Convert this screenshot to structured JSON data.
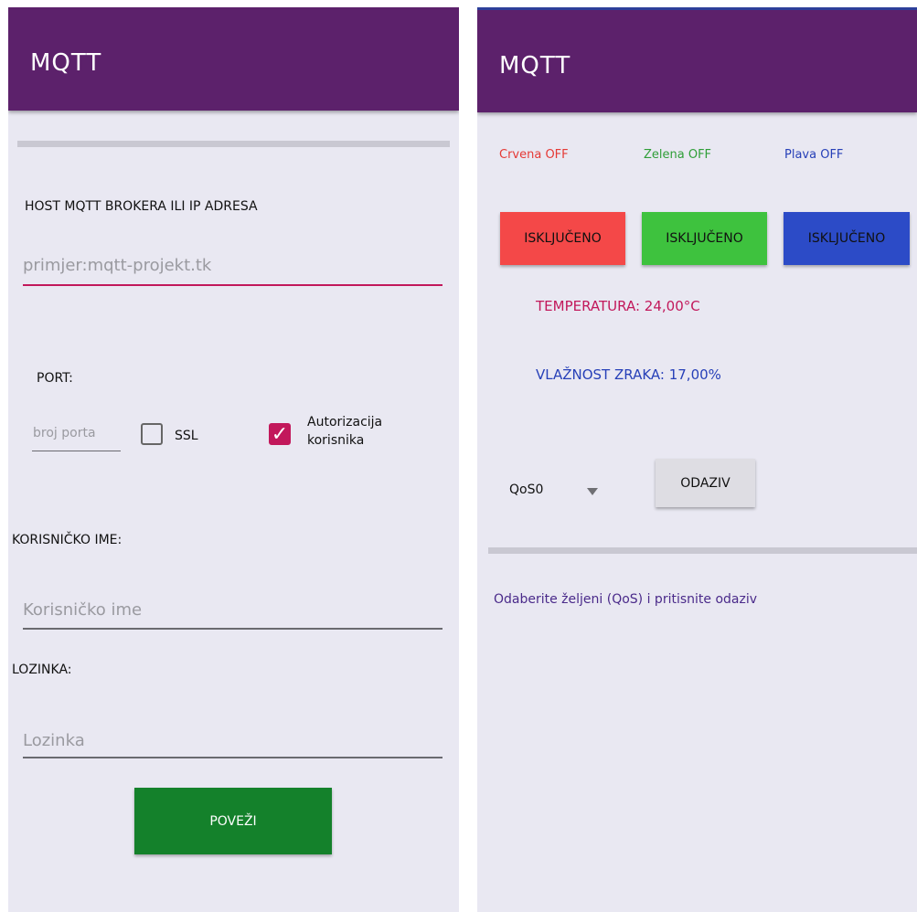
{
  "left": {
    "appbar": {
      "title": "MQTT"
    },
    "host": {
      "label": "HOST MQTT BROKERA ILI IP ADRESA",
      "placeholder": "primjer:mqtt-projekt.tk"
    },
    "port": {
      "label": "PORT:",
      "placeholder": "broj porta"
    },
    "ssl": {
      "label": "SSL",
      "checked": false
    },
    "auth": {
      "label_line1": "Autorizacija",
      "label_line2": "korisnika",
      "checked": true
    },
    "username": {
      "label": "KORISNIČKO IME:",
      "placeholder": "Korisničko ime"
    },
    "password": {
      "label": "LOZINKA:",
      "placeholder": "Lozinka"
    },
    "connect_button": {
      "label": "POVEŽI",
      "color": "#14812b"
    }
  },
  "right": {
    "appbar": {
      "title": "MQTT"
    },
    "leds": [
      {
        "label": "Crvena OFF",
        "color": "#e53935"
      },
      {
        "label": "Zelena OFF",
        "color": "#2e9e37"
      },
      {
        "label": "Plava OFF",
        "color": "#2740b8"
      }
    ],
    "buttons": [
      {
        "label": "ISKLJUČENO",
        "color": "#f44848"
      },
      {
        "label": "ISKLJUČENO",
        "color": "#3ec23e"
      },
      {
        "label": "ISKLJUČENO",
        "color": "#2c4bc7"
      }
    ],
    "temperature": {
      "text": "TEMPERATURA: 24,00°C",
      "color": "#c2185b"
    },
    "humidity": {
      "text": "VLAŽNOST ZRAKA: 17,00%",
      "color": "#2740b8"
    },
    "qos": {
      "selected": "QoS0"
    },
    "response_button": {
      "label": "ODAZIV"
    },
    "message": {
      "text": "Odaberite željeni (QoS) i pritisnite odaziv",
      "color": "#4a2a8a"
    }
  }
}
